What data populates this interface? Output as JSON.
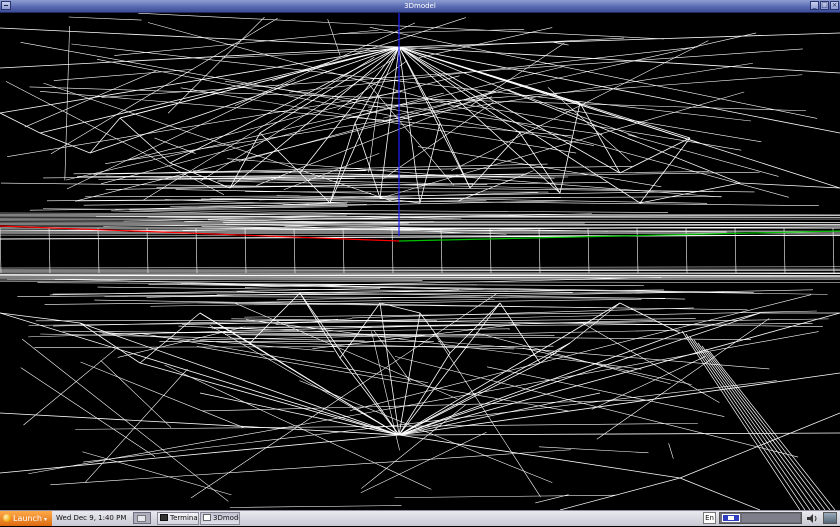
{
  "window": {
    "title": "3Dmodel"
  },
  "taskbar": {
    "launch_label": "Launch",
    "clock": "Wed Dec  9,  1:40 PM",
    "tasks": [
      {
        "label": "Terminal",
        "icon": "terminal-icon"
      },
      {
        "label": "3Dmodel",
        "icon": "window-icon"
      }
    ],
    "language": "En"
  },
  "colors": {
    "background": "#000000",
    "wireframe": "#ffffff",
    "axis_x": "#ff0000",
    "axis_y": "#00c000",
    "axis_z": "#2020ff",
    "titlebar": "#5a6bb3",
    "launch": "#f08a20"
  }
}
